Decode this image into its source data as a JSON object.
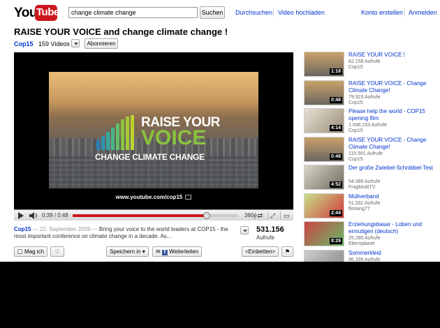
{
  "header": {
    "logo_you": "You",
    "logo_tube": "Tube",
    "search_value": "change climate change",
    "search_button": "Suchen",
    "browse": "Durchsuchen",
    "upload": "Video hochladen",
    "create_account": "Konto erstellen",
    "sign_in": "Anmelden"
  },
  "video": {
    "title": "RAISE YOUR VOICE and change climate change !",
    "channel": "Cop15",
    "video_count": "159 Videos",
    "subscribe": "Abonnieren",
    "overlay_line1": "RAISE YOUR",
    "overlay_line2": "VOICE",
    "overlay_line3": "CHANGE CLIMATE CHANGE",
    "overlay_url": "www.youtube.com/cop15",
    "time": "0:39 / 0:48",
    "progress": 0.8125,
    "quality": "360p",
    "brand_green": "#8ac43f"
  },
  "description": {
    "channel": "Cop15",
    "date": " — 22. September 2009 — ",
    "text": "Bring your voice to the world leaders at COP15 - the most important conference on climate change in a decade. As...",
    "views": "531.156",
    "views_label": "Aufrufe"
  },
  "actions": {
    "like": "Mag ich",
    "save": "Speichern in",
    "share": "Weiterleiten",
    "embed": "<Einbetten>"
  },
  "related": [
    {
      "title": "RAISE YOUR VOICE !",
      "views": "62.158 Aufrufe",
      "user": "Cop15",
      "duration": "1:18"
    },
    {
      "title": "RAISE YOUR VOICE - Change Climate Change!",
      "views": "79.923 Aufrufe",
      "user": "Cop15",
      "duration": "0:48"
    },
    {
      "title": "Please help the world - COP15 opening film",
      "views": "1.046.233 Aufrufe",
      "user": "Cop15",
      "duration": "4:14"
    },
    {
      "title": "RAISE YOUR VOICE - Change Climate Change!",
      "views": "115.591 Aufrufe",
      "user": "Cop15",
      "duration": "0:48"
    },
    {
      "title": "Der große Zwiebel-Schnibbel-Test",
      "views": "54.389 Aufrufe",
      "user": "FragMuttiTV",
      "duration": "4:52"
    },
    {
      "title": "Müllverband",
      "views": "51.332 Aufrufe",
      "user": "floriang77",
      "duration": "2:44"
    },
    {
      "title": "Erziehungsbasar - Loben und ermutigen (deutsch)",
      "views": "25.280 Aufrufe",
      "user": "Elternplanet",
      "duration": "8:29"
    },
    {
      "title": "Sommerkleid",
      "views": "96.339 Aufrufe",
      "user": "",
      "duration": ""
    }
  ]
}
